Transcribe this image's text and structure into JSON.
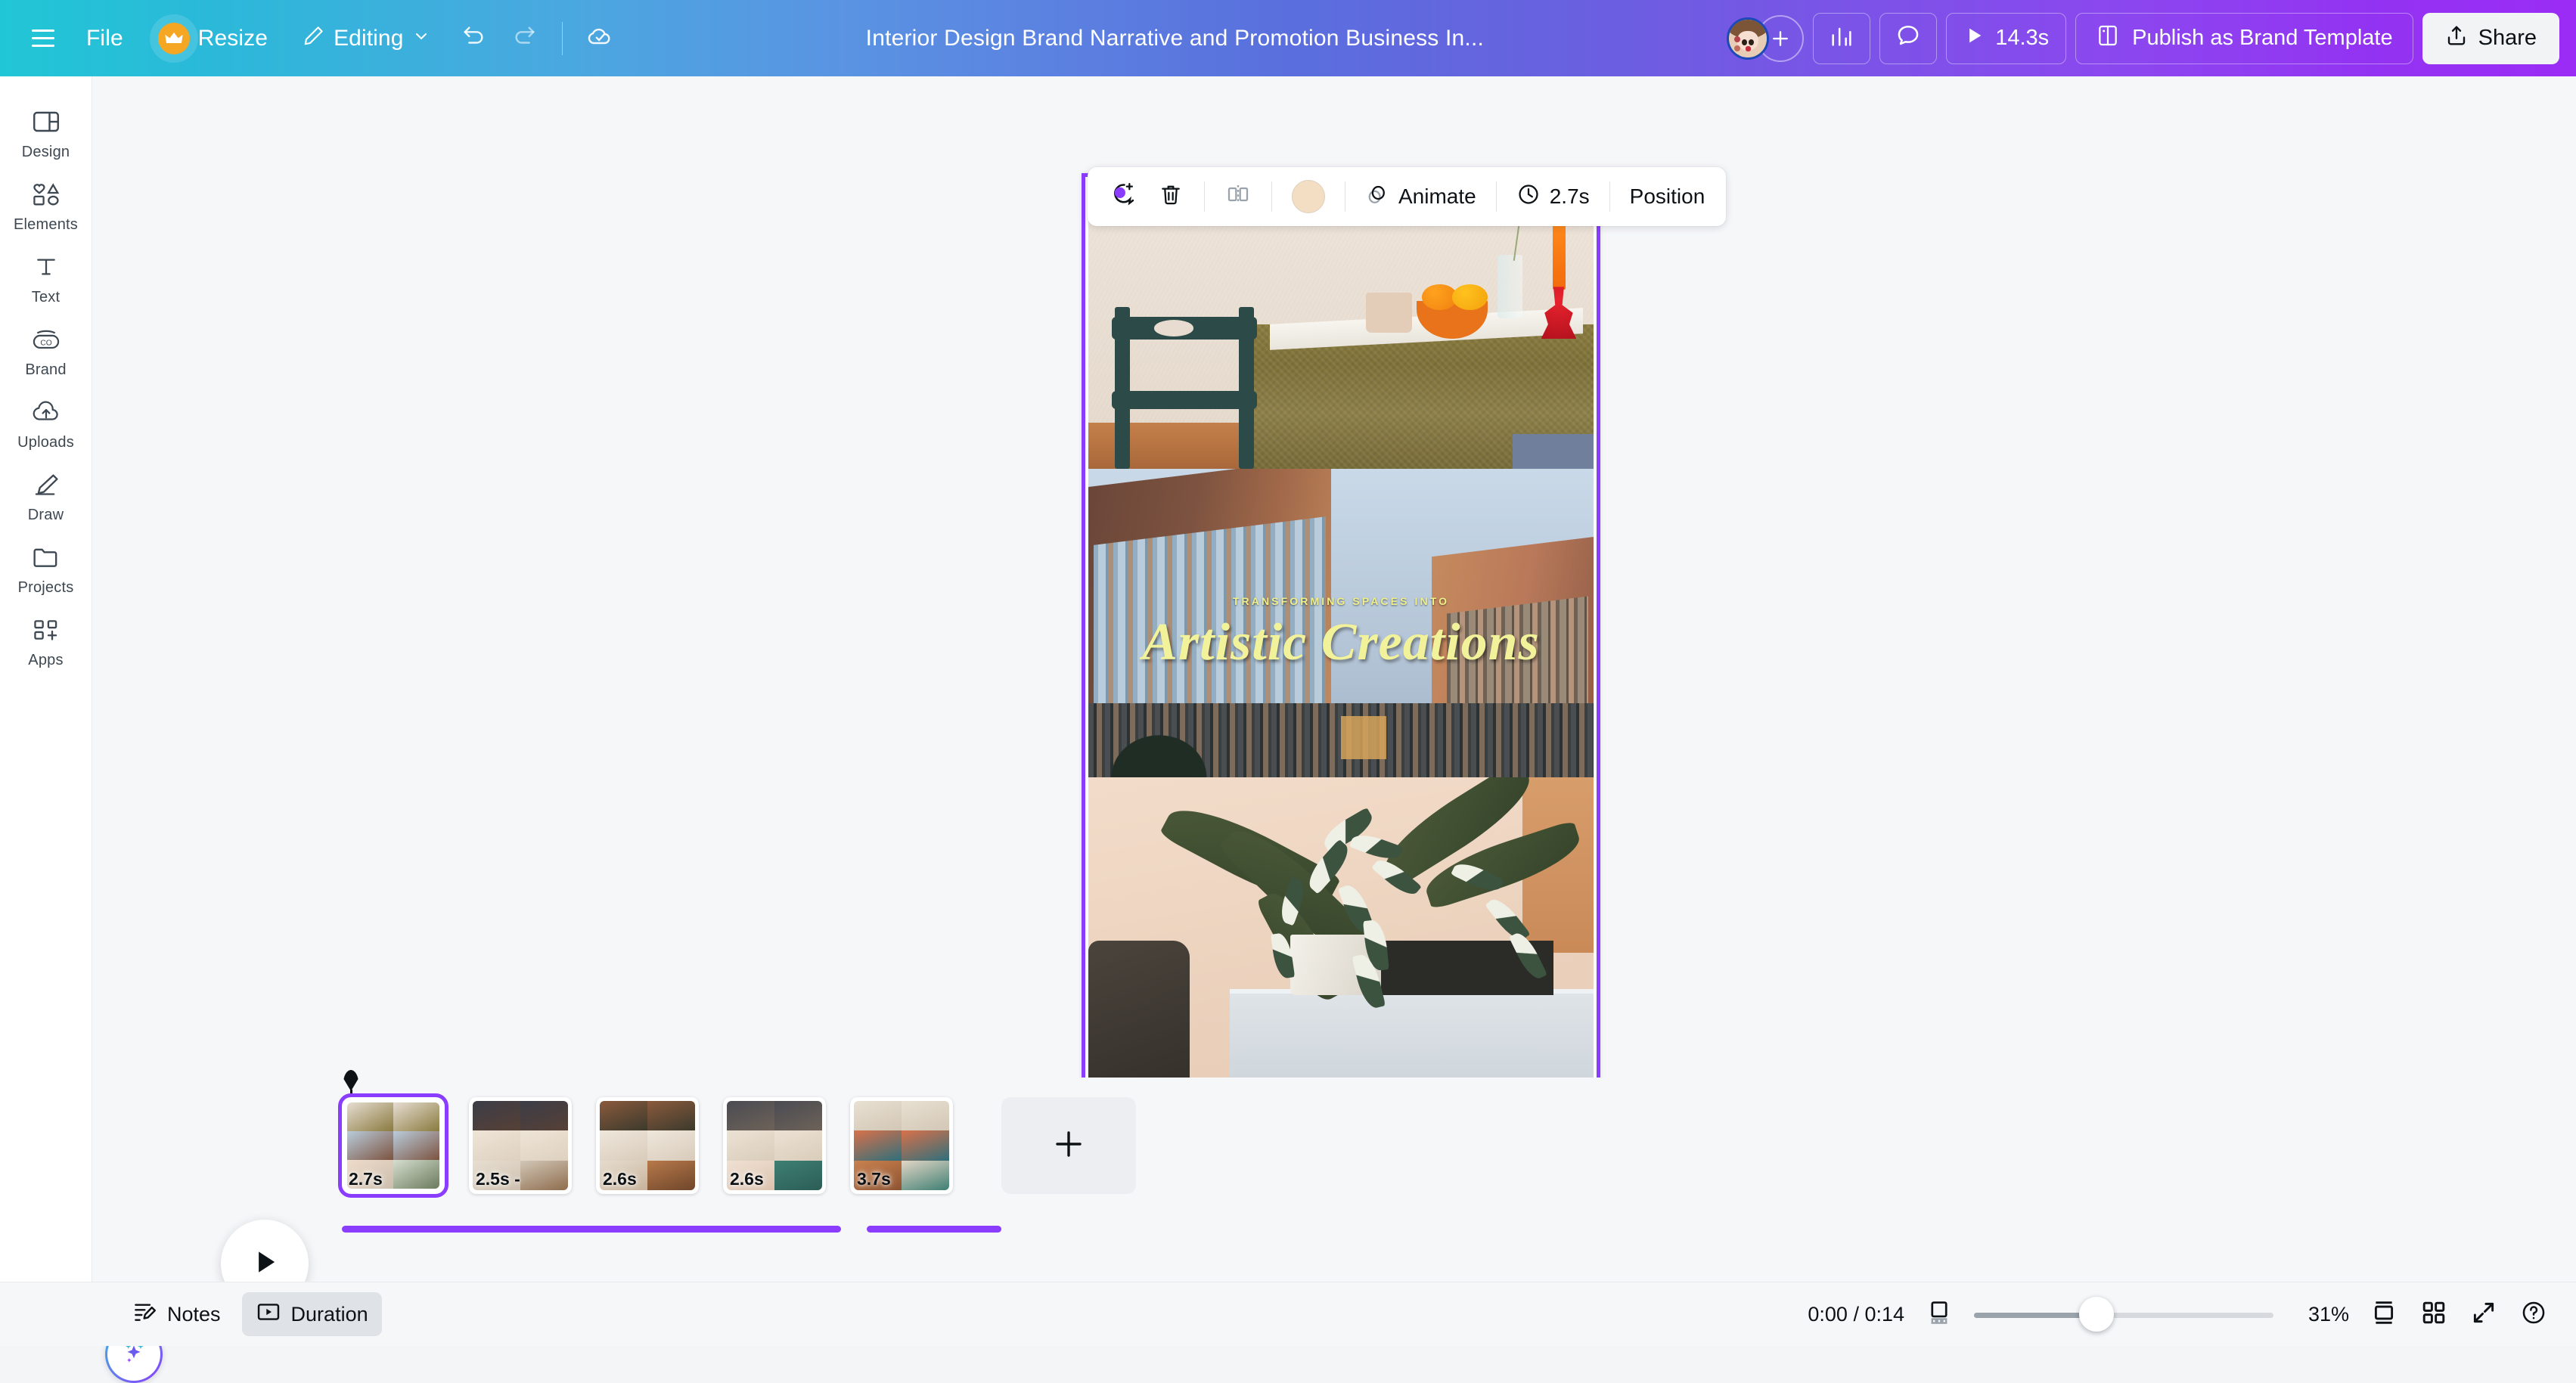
{
  "header": {
    "menu_icon": "hamburger-icon",
    "file_label": "File",
    "resize_label": "Resize",
    "resize_badge_icon": "crown-icon",
    "editing_label": "Editing",
    "editing_caret_icon": "chevron-down-icon",
    "undo_icon": "undo-icon",
    "redo_icon": "redo-icon",
    "saved_icon": "cloud-check-icon",
    "doc_title": "Interior Design Brand Narrative and Promotion  Business In...",
    "avatar_name": "avatar",
    "add_member_icon": "plus-icon",
    "insights_icon": "bar-chart-icon",
    "comment_icon": "comment-icon",
    "play_icon": "play-icon",
    "total_duration": "14.3s",
    "publish_icon": "brand-template-icon",
    "publish_label": "Publish as Brand Template",
    "share_icon": "share-upload-icon",
    "share_label": "Share"
  },
  "sidebar": {
    "items": [
      {
        "label": "Design",
        "icon": "design-icon"
      },
      {
        "label": "Elements",
        "icon": "elements-icon"
      },
      {
        "label": "Text",
        "icon": "text-icon"
      },
      {
        "label": "Brand",
        "icon": "brand-icon"
      },
      {
        "label": "Uploads",
        "icon": "uploads-cloud-icon"
      },
      {
        "label": "Draw",
        "icon": "draw-pen-icon"
      },
      {
        "label": "Projects",
        "icon": "projects-folder-icon"
      },
      {
        "label": "Apps",
        "icon": "apps-grid-plus-icon"
      }
    ]
  },
  "element_toolbar": {
    "magic_icon": "magic-edit-icon",
    "delete_icon": "trash-icon",
    "flip_icon": "flip-icon",
    "color_swatch": "#f3ddc3",
    "animate_icon": "animate-icon",
    "animate_label": "Animate",
    "timer_icon": "clock-icon",
    "duration_label": "2.7s",
    "position_label": "Position"
  },
  "canvas": {
    "selection_color": "#8b3dff",
    "panels": [
      {
        "name": "dining-table-photo"
      },
      {
        "name": "building-facade-photo",
        "kicker": "TRANSFORMING SPACES INTO",
        "script": "Artistic Creations",
        "text_color": "#f2f29a"
      },
      {
        "name": "plant-photo"
      }
    ]
  },
  "timeline": {
    "scenes": [
      {
        "duration": "2.7s",
        "selected": true
      },
      {
        "duration": "2.5s -",
        "selected": false
      },
      {
        "duration": "2.6s",
        "selected": false
      },
      {
        "duration": "2.6s",
        "selected": false
      },
      {
        "duration": "3.7s",
        "selected": false
      }
    ],
    "add_page_icon": "plus-icon",
    "play_icon": "play-icon",
    "magic_icon": "magic-sparkle-icon"
  },
  "bottombar": {
    "notes_icon": "notes-icon",
    "notes_label": "Notes",
    "duration_icon": "duration-icon",
    "duration_label": "Duration",
    "time_display": "0:00 / 0:14",
    "fit_icon": "fit-page-icon",
    "zoom_level": "31%",
    "page_view_icon": "single-page-icon",
    "grid_view_icon": "grid-view-icon",
    "fullscreen_icon": "fullscreen-icon",
    "help_icon": "help-icon"
  }
}
